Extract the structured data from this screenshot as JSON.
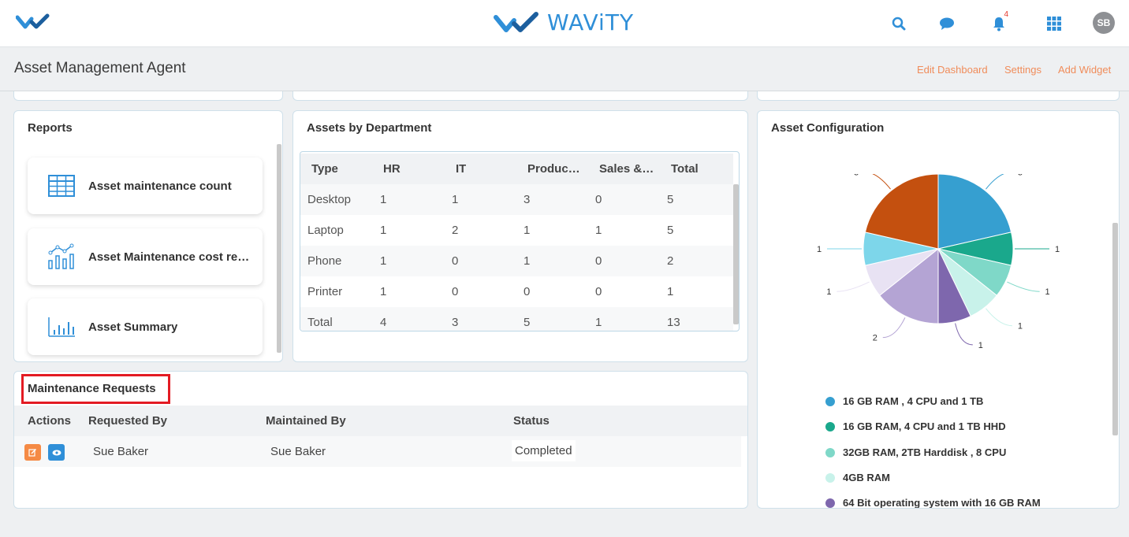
{
  "header": {
    "brand": "WAViTY",
    "notification_count": "4",
    "avatar_initials": "SB"
  },
  "subheader": {
    "title": "Asset Management Agent",
    "links": [
      "Edit Dashboard",
      "Settings",
      "Add Widget"
    ]
  },
  "reports": {
    "title": "Reports",
    "items": [
      {
        "label": "Asset maintenance count",
        "icon": "table-grid-icon"
      },
      {
        "label": "Asset Maintenance cost rep…",
        "icon": "line-bar-chart-icon"
      },
      {
        "label": "Asset Summary",
        "icon": "bar-chart-icon"
      }
    ]
  },
  "departments": {
    "title": "Assets by Department",
    "columns": [
      "Type",
      "HR",
      "IT",
      "Produc…",
      "Sales &…",
      "Total"
    ],
    "rows": [
      [
        "Desktop",
        "1",
        "1",
        "3",
        "0",
        "5"
      ],
      [
        "Laptop",
        "1",
        "2",
        "1",
        "1",
        "5"
      ],
      [
        "Phone",
        "1",
        "0",
        "1",
        "0",
        "2"
      ],
      [
        "Printer",
        "1",
        "0",
        "0",
        "0",
        "1"
      ],
      [
        "Total",
        "4",
        "3",
        "5",
        "1",
        "13"
      ]
    ]
  },
  "maintenance": {
    "title": "Maintenance Requests",
    "columns": [
      "Actions",
      "Requested By",
      "Maintained By",
      "Status"
    ],
    "rows": [
      {
        "requested_by": "Sue Baker",
        "maintained_by": "Sue Baker",
        "status": "Completed"
      }
    ]
  },
  "asset_config": {
    "title": "Asset Configuration",
    "legend": [
      "16 GB RAM , 4 CPU and 1 TB",
      "16 GB RAM, 4 CPU and 1 TB HHD",
      "32GB RAM, 2TB Harddisk , 8 CPU",
      "4GB RAM",
      "64 Bit operating system with 16 GB RAM"
    ]
  },
  "chart_data": {
    "type": "pie",
    "slices": [
      {
        "label": "16 GB RAM , 4 CPU and 1 TB",
        "value": 3,
        "color": "#369fd0"
      },
      {
        "label": "16 GB RAM, 4 CPU and 1 TB HHD",
        "value": 1,
        "color": "#1aa88c"
      },
      {
        "label": "32GB RAM, 2TB Harddisk , 8 CPU",
        "value": 1,
        "color": "#7fd8c8"
      },
      {
        "label": "4GB RAM",
        "value": 1,
        "color": "#c8f2ea"
      },
      {
        "label": "64 Bit operating system with 16 GB RAM",
        "value": 1,
        "color": "#7e67ad"
      },
      {
        "label": "",
        "value": 2,
        "color": "#b4a4d4"
      },
      {
        "label": "",
        "value": 1,
        "color": "#e8e2f3"
      },
      {
        "label": "",
        "value": 1,
        "color": "#7dd6ea"
      },
      {
        "label": "",
        "value": 3,
        "color": "#c4500f"
      }
    ],
    "legend_position": "bottom"
  }
}
